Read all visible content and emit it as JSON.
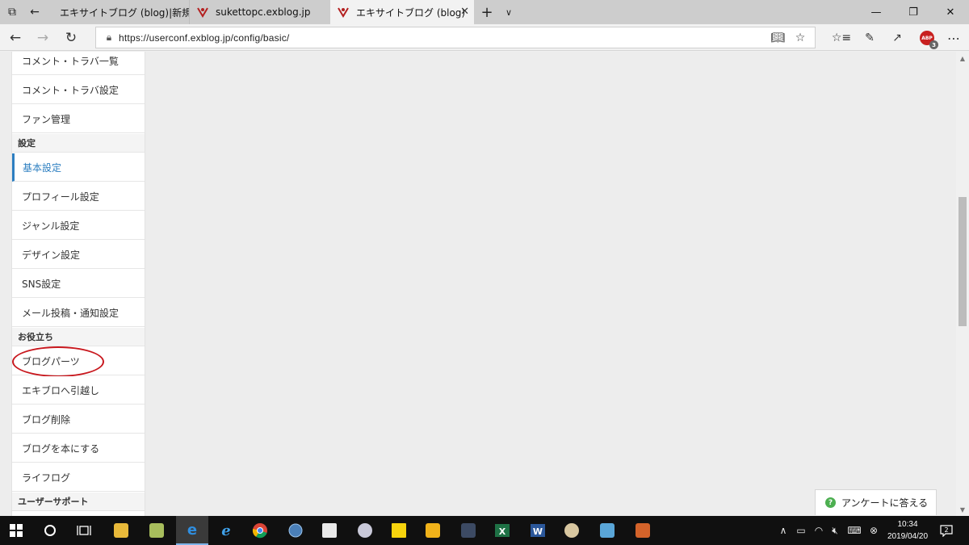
{
  "browser": {
    "tabs": [
      {
        "label": "エキサイトブログ (blog)|新規投",
        "active": false
      },
      {
        "label": "sukettopc.exblog.jp",
        "active": false
      },
      {
        "label": "エキサイトブログ (blog)",
        "active": true
      }
    ],
    "url": "https://userconf.exblog.jp/config/basic/"
  },
  "sidebar": {
    "items": [
      {
        "type": "item",
        "label": "コメント・トラバ一覧"
      },
      {
        "type": "item",
        "label": "コメント・トラバ設定"
      },
      {
        "type": "item",
        "label": "ファン管理"
      },
      {
        "type": "header",
        "label": "設定"
      },
      {
        "type": "item",
        "label": "基本設定",
        "active": true
      },
      {
        "type": "item",
        "label": "プロフィール設定"
      },
      {
        "type": "item",
        "label": "ジャンル設定"
      },
      {
        "type": "item",
        "label": "デザイン設定"
      },
      {
        "type": "item",
        "label": "SNS設定"
      },
      {
        "type": "item",
        "label": "メール投稿・通知設定"
      },
      {
        "type": "header",
        "label": "お役立ち"
      },
      {
        "type": "item",
        "label": "ブログパーツ",
        "highlighted": true
      },
      {
        "type": "item",
        "label": "エキブロへ引越し"
      },
      {
        "type": "item",
        "label": "ブログ削除"
      },
      {
        "type": "item",
        "label": "ブログを本にする"
      },
      {
        "type": "item",
        "label": "ライフログ"
      },
      {
        "type": "header",
        "label": "ユーザーサポート"
      }
    ]
  },
  "survey_button": {
    "label": "アンケートに答える"
  },
  "toolbar": {
    "abp_count": "3",
    "abp_label": "ABP"
  },
  "taskbar": {
    "time": "10:34",
    "date": "2019/04/20",
    "notifications": "2",
    "apps": [
      "start",
      "cortana",
      "task-view",
      "file-explorer",
      "folder",
      "edge",
      "internet-explorer",
      "chrome",
      "globe",
      "store",
      "paint-brush",
      "sticky-notes",
      "app-yellow",
      "app-dark",
      "excel",
      "word",
      "paint",
      "remote",
      "toolbox"
    ]
  },
  "colors": {
    "accent": "#2d7fc1",
    "highlight_circle": "#c8171d",
    "survey_icon": "#4caf50"
  }
}
